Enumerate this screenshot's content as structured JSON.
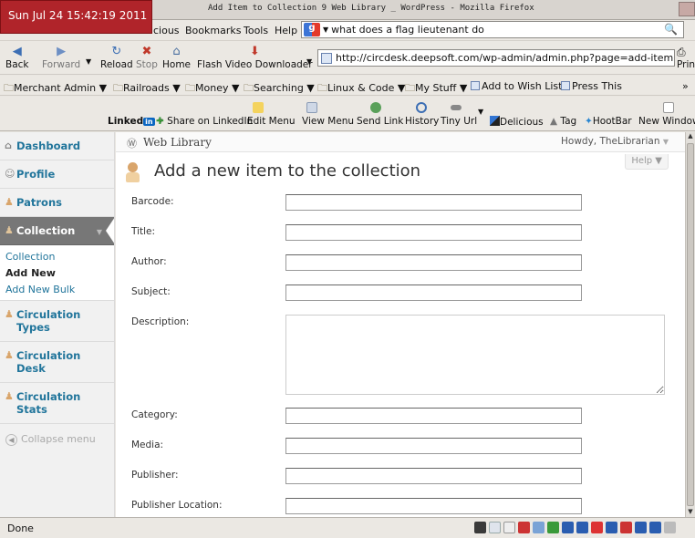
{
  "clock": "Sun Jul 24 15:42:19 2011",
  "window_title": "Add Item to Collection  9 Web Library  _ WordPress - Mozilla Firefox",
  "menubar": {
    "items": [
      "cious",
      "Bookmarks",
      "Tools",
      "Help"
    ],
    "search_value": "what does a flag lieutenant do"
  },
  "navbar": {
    "back": "Back",
    "forward": "Forward",
    "reload": "Reload",
    "stop": "Stop",
    "home": "Home",
    "flash": "Flash Video Downloader",
    "url": "http://circdesk.deepsoft.com/wp-admin/admin.php?page=add-item",
    "print": "Print"
  },
  "bookmarks": [
    "Merchant Admin",
    "Railroads",
    "Money",
    "Searching",
    "Linux & Code",
    "My Stuff",
    "Add to Wish List",
    "Press This"
  ],
  "addon_toolbar": {
    "linkedin": "Linked",
    "linkedin_badge": "in",
    "share": "Share on LinkedIn",
    "edit_menu": "Edit Menu",
    "view_menu": "View Menu",
    "send_link": "Send Link",
    "history": "History",
    "tiny_url": "Tiny Url",
    "delicious": "Delicious",
    "tag": "Tag",
    "hootbar": "HootBar",
    "new_window": "New Window"
  },
  "sidebar": {
    "items": [
      {
        "label": "Dashboard"
      },
      {
        "label": "Profile"
      },
      {
        "label": "Patrons"
      },
      {
        "label": "Collection"
      },
      {
        "label": "Circulation Types"
      },
      {
        "label": "Circulation Desk"
      },
      {
        "label": "Circulation Stats"
      }
    ],
    "submenu": [
      "Collection",
      "Add New",
      "Add New Bulk"
    ],
    "collapse": "Collapse menu"
  },
  "wp_header": {
    "site_name": "Web Library",
    "howdy": "Howdy, TheLibrarian",
    "help": "Help"
  },
  "page": {
    "title": "Add a new item to the collection"
  },
  "form": {
    "barcode": "Barcode:",
    "title": "Title:",
    "author": "Author:",
    "subject": "Subject:",
    "description": "Description:",
    "category": "Category:",
    "media": "Media:",
    "publisher": "Publisher:",
    "publisher_location": "Publisher Location:"
  },
  "status": "Done"
}
